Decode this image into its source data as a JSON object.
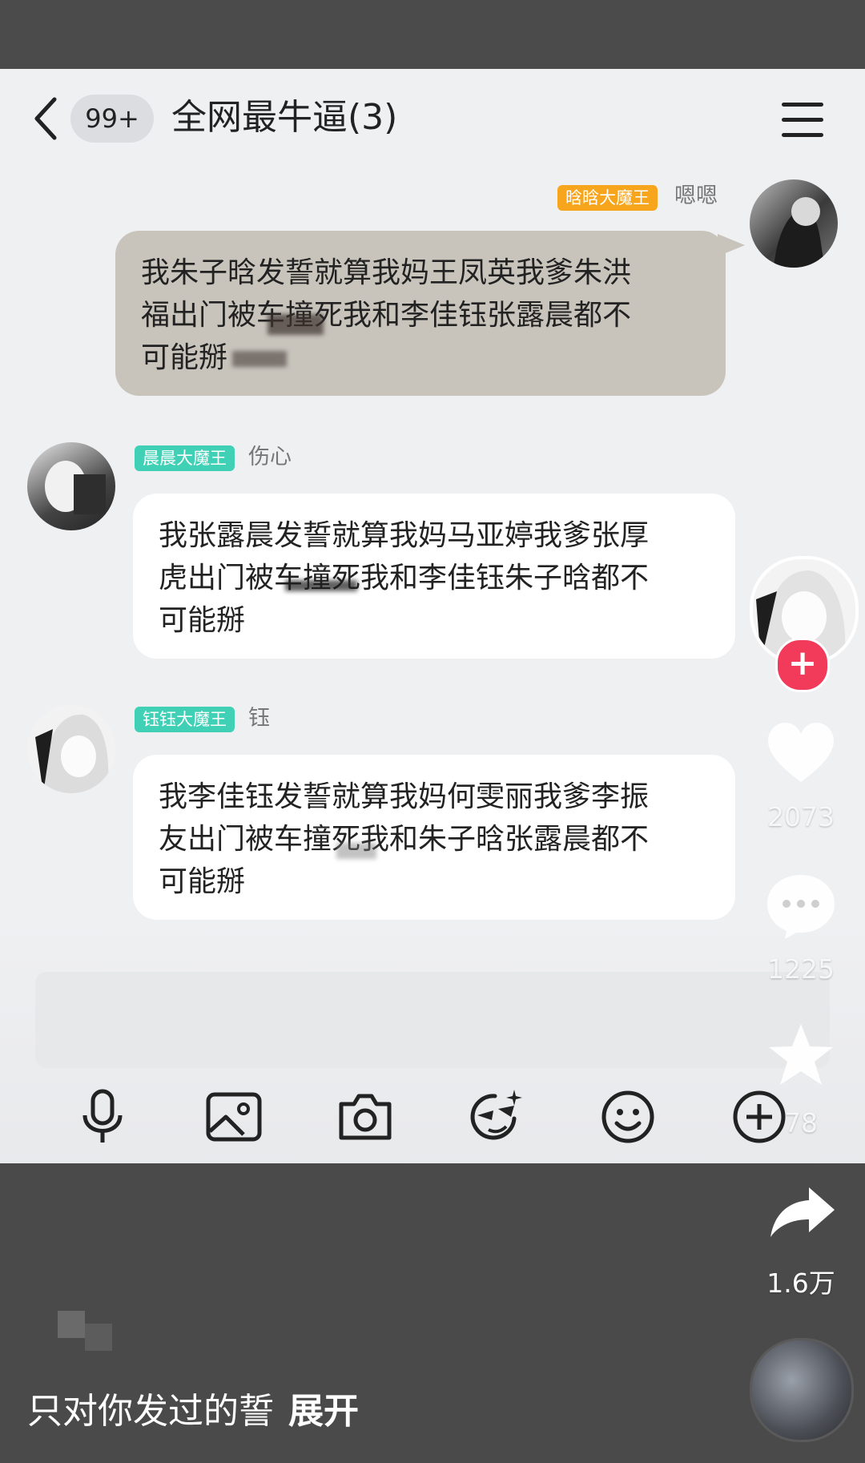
{
  "chat": {
    "title": "全网最牛逼(3)",
    "unread_badge": "99+",
    "messages": [
      {
        "tag": "晗晗大魔王",
        "tag_color": "#f7a51c",
        "nick": "嗯嗯",
        "text": [
          "我朱子晗发誓就算我妈王凤英我爹朱洪",
          "福出门被车撞死我和李佳钰张露晨都不",
          "可能掰"
        ]
      },
      {
        "tag": "晨晨大魔王",
        "tag_color": "#3fd0b6",
        "nick": "伤心",
        "text": [
          "我张露晨发誓就算我妈马亚婷我爹张厚",
          "虎出门被车撞死我和李佳钰朱子晗都不",
          "可能掰"
        ]
      },
      {
        "tag": "钰钰大魔王",
        "tag_color": "#3fd0b6",
        "nick": "钰",
        "text": [
          "我李佳钰发誓就算我妈何雯丽我爹李振",
          "友出门被车撞死我和朱子晗张露晨都不",
          "可能掰"
        ]
      }
    ]
  },
  "toolbar": {
    "icons": [
      "mic-icon",
      "image-icon",
      "camera-icon",
      "sticker-face-icon",
      "emoji-icon",
      "plus-circle-icon"
    ]
  },
  "video_rail": {
    "likes": "2073",
    "comments": "1225",
    "favorites": "78",
    "shares": "1.6万"
  },
  "caption": {
    "text": "只对你发过的誓",
    "expand": "展开"
  },
  "colors": {
    "sent_bubble": "#c8c4bc",
    "received_bubble": "#ffffff",
    "follow_button": "#f23a5a"
  }
}
